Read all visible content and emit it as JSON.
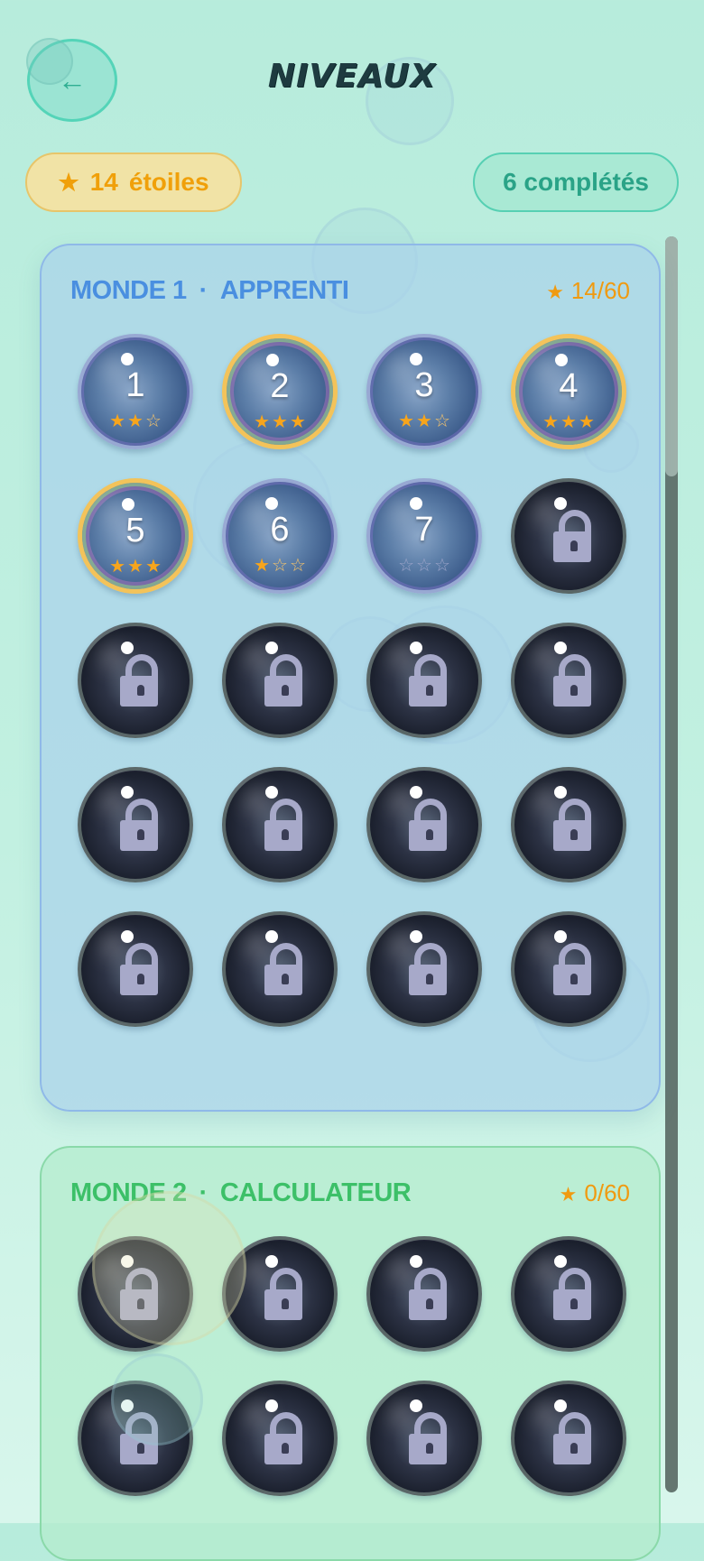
{
  "header": {
    "back_icon": "arrow-left-icon",
    "title": "NIVEAUX"
  },
  "stats": {
    "stars_icon": "star-icon",
    "stars_count": "14",
    "stars_label": "étoiles",
    "completed_label": "6 complétés"
  },
  "colors": {
    "background": "#b7ecdc",
    "world1_accent": "#4a8fe0",
    "world2_accent": "#3cc068",
    "star_color": "#f09a10",
    "pill_completed": "#2aa387"
  },
  "worlds": [
    {
      "name": "MONDE 1",
      "separator": "·",
      "subtitle": "APPRENTI",
      "star_glyph": "★",
      "score": "14/60",
      "levels": [
        {
          "number": "1",
          "stars": 2,
          "locked": false
        },
        {
          "number": "2",
          "stars": 3,
          "locked": false
        },
        {
          "number": "3",
          "stars": 2,
          "locked": false
        },
        {
          "number": "4",
          "stars": 3,
          "locked": false
        },
        {
          "number": "5",
          "stars": 3,
          "locked": false
        },
        {
          "number": "6",
          "stars": 1,
          "locked": false
        },
        {
          "number": "7",
          "stars": 0,
          "locked": false
        },
        {
          "locked": true
        },
        {
          "locked": true
        },
        {
          "locked": true
        },
        {
          "locked": true
        },
        {
          "locked": true
        },
        {
          "locked": true
        },
        {
          "locked": true
        },
        {
          "locked": true
        },
        {
          "locked": true
        },
        {
          "locked": true
        },
        {
          "locked": true
        },
        {
          "locked": true
        },
        {
          "locked": true
        }
      ]
    },
    {
      "name": "MONDE 2",
      "separator": "·",
      "subtitle": "CALCULATEUR",
      "star_glyph": "★",
      "score": "0/60",
      "levels": [
        {
          "locked": true
        },
        {
          "locked": true
        },
        {
          "locked": true
        },
        {
          "locked": true
        },
        {
          "locked": true
        },
        {
          "locked": true
        },
        {
          "locked": true
        },
        {
          "locked": true
        }
      ]
    }
  ]
}
